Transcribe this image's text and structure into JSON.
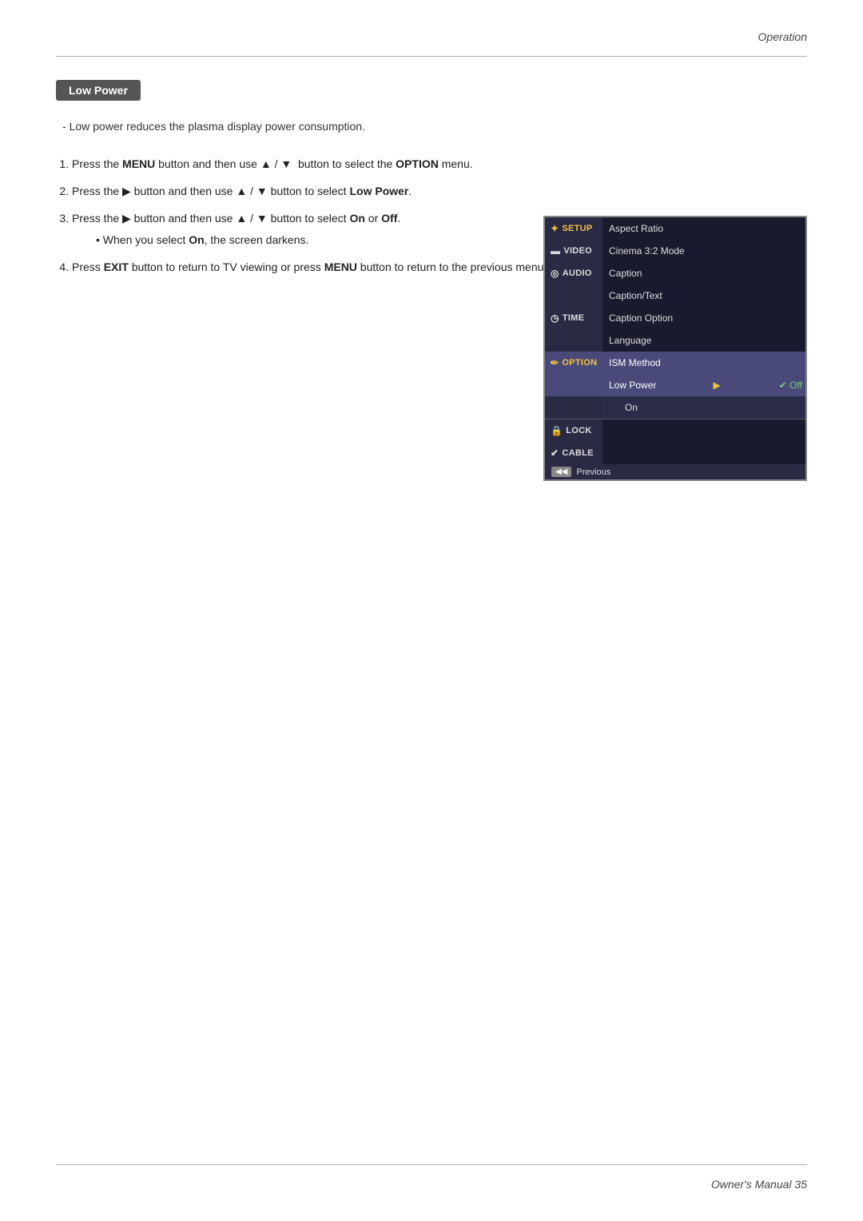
{
  "header": {
    "label": "Operation"
  },
  "footer": {
    "label": "Owner's Manual   35"
  },
  "section": {
    "badge": "Low Power",
    "intro": "Low power reduces the plasma display power consumption."
  },
  "steps": [
    {
      "id": 1,
      "text_parts": [
        {
          "text": "Press the ",
          "bold": false
        },
        {
          "text": "MENU",
          "bold": true
        },
        {
          "text": " button and then use ▲ / ▼  button to select the ",
          "bold": false
        },
        {
          "text": "OPTION",
          "bold": true
        },
        {
          "text": " menu.",
          "bold": false
        }
      ]
    },
    {
      "id": 2,
      "text_parts": [
        {
          "text": "Press the ▶ button and then use ▲ / ▼ button to select ",
          "bold": false
        },
        {
          "text": "Low Power",
          "bold": true
        },
        {
          "text": ".",
          "bold": false
        }
      ]
    },
    {
      "id": 3,
      "text_parts": [
        {
          "text": "Press the ▶ button and then use ▲ / ▼ button to select ",
          "bold": false
        },
        {
          "text": "On",
          "bold": true
        },
        {
          "text": " or ",
          "bold": false
        },
        {
          "text": "Off",
          "bold": true
        },
        {
          "text": ".",
          "bold": false
        }
      ]
    },
    {
      "id": "3a",
      "sub": true,
      "text_parts": [
        {
          "text": "When you select ",
          "bold": false
        },
        {
          "text": "On",
          "bold": true
        },
        {
          "text": ", the screen darkens.",
          "bold": false
        }
      ]
    },
    {
      "id": 4,
      "text_parts": [
        {
          "text": "Press ",
          "bold": false
        },
        {
          "text": "EXIT",
          "bold": true
        },
        {
          "text": " button to return to TV viewing or press ",
          "bold": false
        },
        {
          "text": "MENU",
          "bold": true
        },
        {
          "text": " button to return to the previous menu.",
          "bold": false
        }
      ]
    }
  ],
  "tv_menu": {
    "items": [
      {
        "id": "setup",
        "icon": "✦",
        "label": "SETUP",
        "class": "setup"
      },
      {
        "id": "video",
        "icon": "▬",
        "label": "VIDEO",
        "class": "video"
      },
      {
        "id": "audio",
        "icon": "◎",
        "label": "AUDIO",
        "class": "audio"
      },
      {
        "id": "time",
        "icon": "◷",
        "label": "TIME",
        "class": "time"
      },
      {
        "id": "option",
        "icon": "✏",
        "label": "OPTION",
        "class": "option",
        "active": true
      },
      {
        "id": "lock",
        "icon": "🔒",
        "label": "LOCK",
        "class": "lock"
      },
      {
        "id": "cable",
        "icon": "✔",
        "label": "CABLE",
        "class": "cable"
      }
    ],
    "menu_items": [
      "Aspect Ratio",
      "Cinema 3:2 Mode",
      "Caption",
      "Caption/Text",
      "Caption Option",
      "Language",
      "ISM Method",
      "Low Power",
      ""
    ],
    "low_power_options": [
      {
        "label": "✔ Off",
        "check": true
      },
      {
        "label": "On"
      }
    ],
    "footer_btn": "◀◀",
    "footer_label": "Previous"
  }
}
